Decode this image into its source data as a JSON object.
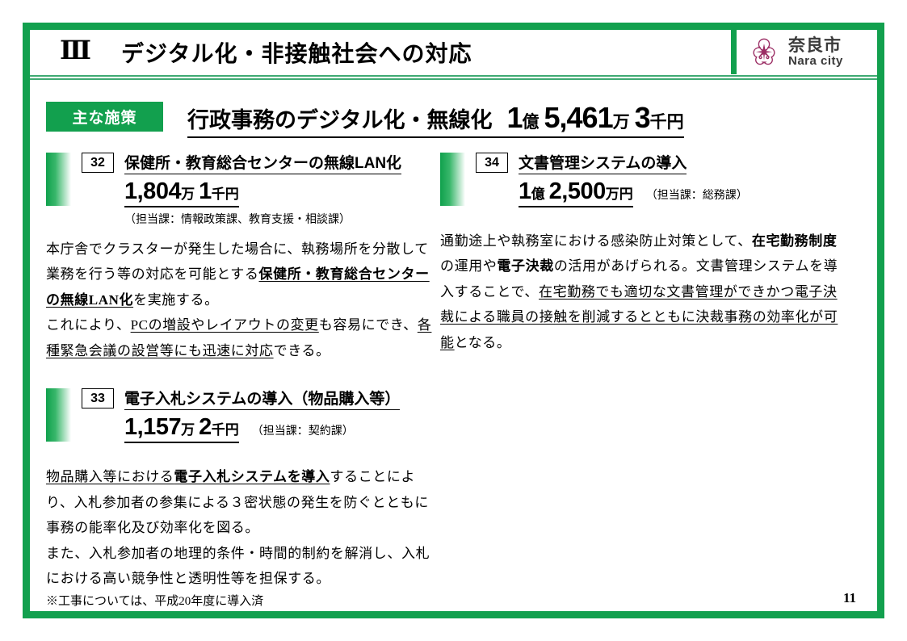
{
  "header": {
    "numeral": "Ⅲ",
    "title": "デジタル化・非接触社会への対応",
    "logo_jp": "奈良市",
    "logo_en": "Nara city",
    "logo_icon": "nara-cherry-blossom-deer-crest"
  },
  "title_row": {
    "badge": "主な施策",
    "title_text": "行政事務のデジタル化・無線化",
    "amount": {
      "n1": "1",
      "u1": "億",
      "n2": "5,461",
      "u2": "万",
      "n3": "3",
      "u3": "千円"
    }
  },
  "colors": {
    "green": "#12A04E",
    "green_bar": "#0FA04C",
    "rule": "#3faa72",
    "logo_crest": "#9B2D64"
  },
  "items": [
    {
      "number": "32",
      "title": "保健所・教育総合センターの無線LAN化",
      "amount": {
        "n1": "1,804",
        "u1": "万",
        "n2": "1",
        "u2": "千円"
      },
      "dept": "（担当課：情報政策課、教育支援・相談課）",
      "dept_position": "below",
      "body": [
        {
          "text": "本庁舎でクラスターが発生した場合に、執務場所を分散して業務を行う等の対応を可能とする",
          "style": "plain"
        },
        {
          "text": "保健所・教育総合センターの無線LAN化",
          "style": "bold-underline"
        },
        {
          "text": "を実施する。",
          "style": "plain"
        },
        {
          "text": "\nこれにより、",
          "style": "plain"
        },
        {
          "text": "PCの増設やレイアウトの変更",
          "style": "underline"
        },
        {
          "text": "も容易にでき、",
          "style": "plain"
        },
        {
          "text": "各種緊急会議の設営等にも迅速に対応",
          "style": "underline"
        },
        {
          "text": "できる。",
          "style": "plain"
        }
      ]
    },
    {
      "number": "33",
      "title": "電子入札システムの導入（物品購入等）",
      "amount": {
        "n1": "1,157",
        "u1": "万",
        "n2": "2",
        "u2": "千円"
      },
      "dept": "（担当課：契約課）",
      "dept_position": "inline",
      "body": [
        {
          "text": "物品購入等における",
          "style": "underline"
        },
        {
          "text": "電子入札システムを導入",
          "style": "bold-underline"
        },
        {
          "text": "することにより、入札参加者の参集による３密状態の発生を防ぐとともに事務の能率化及び効率化を図る。",
          "style": "plain"
        },
        {
          "text": "\nまた、入札参加者の地理的条件・時間的制約を解消し、入札における高い競争性と透明性等を担保する。",
          "style": "plain"
        },
        {
          "text": "\n※工事については、平成20年度に導入済",
          "style": "note"
        }
      ]
    },
    {
      "number": "34",
      "title": "文書管理システムの導入",
      "amount": {
        "n1": "1",
        "u1": "億",
        "n2": "2,500",
        "u2": "万円"
      },
      "dept": "（担当課：総務課）",
      "dept_position": "inline",
      "body": [
        {
          "text": "通勤途上や執務室における感染防止対策として、",
          "style": "plain"
        },
        {
          "text": "在宅勤務制度",
          "style": "bold"
        },
        {
          "text": "の運用や",
          "style": "plain"
        },
        {
          "text": "電子決裁",
          "style": "bold"
        },
        {
          "text": "の活用があげられる。文書管理システムを導入することで、",
          "style": "plain"
        },
        {
          "text": "在宅勤務でも適切な文書管理ができかつ電子決裁による職員の接触を削減するとともに決裁事務の効率化が可能",
          "style": "underline"
        },
        {
          "text": "となる。",
          "style": "plain"
        }
      ]
    }
  ],
  "footer": {
    "page_number": "11"
  }
}
